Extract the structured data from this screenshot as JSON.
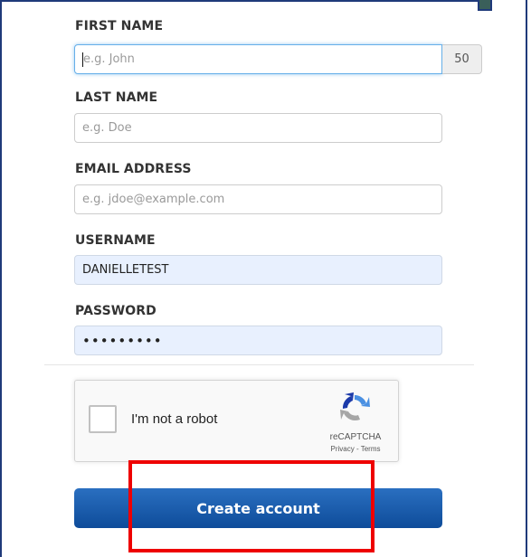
{
  "form": {
    "first_name": {
      "label": "FIRST NAME",
      "placeholder": "e.g. John",
      "value": "",
      "counter": "50"
    },
    "last_name": {
      "label": "LAST NAME",
      "placeholder": "e.g. Doe",
      "value": ""
    },
    "email": {
      "label": "EMAIL ADDRESS",
      "placeholder": "e.g. jdoe@example.com",
      "value": ""
    },
    "username": {
      "label": "USERNAME",
      "value": "DANIELLETEST"
    },
    "password": {
      "label": "PASSWORD",
      "value": "•••••••••"
    }
  },
  "recaptcha": {
    "checkbox_label": "I'm not a robot",
    "brand": "reCAPTCHA",
    "links": "Privacy - Terms",
    "checked": false
  },
  "submit": {
    "label": "Create account"
  },
  "colors": {
    "button_top": "#2a6fc0",
    "button_bottom": "#0e4c9a",
    "autofill_bg": "#e8f0fe",
    "highlight": "#ee0000",
    "focus_border": "#66afe9"
  }
}
